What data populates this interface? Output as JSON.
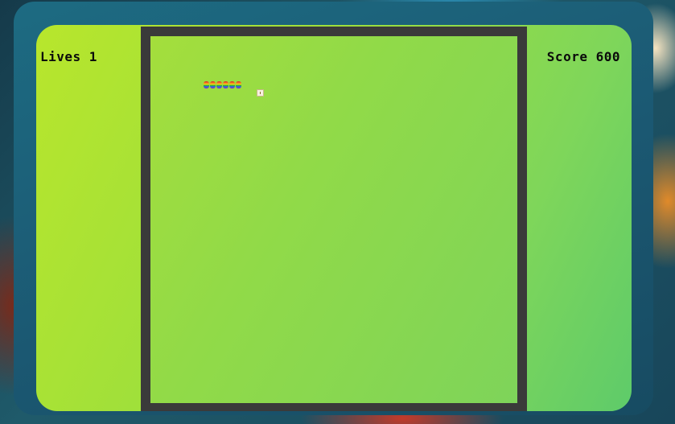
{
  "hud": {
    "lives_label": "Lives 1",
    "score_label": "Score 600",
    "lives": 1,
    "score": 600
  },
  "board": {
    "snake_segments": 6,
    "snake_style": "rainbow-stripes",
    "food_icon": "food-pellet-icon"
  },
  "colors": {
    "panel_gradient_start": "#b8e62c",
    "panel_gradient_end": "#5ecb6a",
    "board_border": "#3a3a3a",
    "text": "#0b0b0b"
  }
}
